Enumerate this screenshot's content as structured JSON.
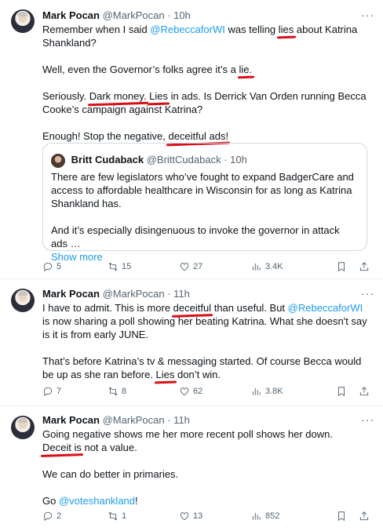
{
  "tweets": [
    {
      "author": "Mark Pocan",
      "handle": "@MarkPocan",
      "dot": "·",
      "time": "10h",
      "more": "···",
      "text": {
        "l1a": "Remember when I said ",
        "l1link": "@RebeccaforWI",
        "l1b": " was telling ",
        "l1u": "lies",
        "l1c": " about Katrina Shankland?",
        "l2a": "Well, even the Governor’s folks agree it’s a ",
        "l2u": "lie.",
        "l3a": "Seriously. ",
        "l3u1": "Dark money.",
        "l3sp": " ",
        "l3u2": "Lies",
        "l3b": " in ads. Is Derrick Van Orden running Becca Cooke’s campaign against Katrina?",
        "l4a": "Enough! Stop the negative, ",
        "l4u": "deceitful ads!"
      },
      "quote": {
        "author": "Britt Cudaback",
        "handle": "@BrittCudaback",
        "dot": "·",
        "time": "10h",
        "p1": "There are few legislators who’ve fought to expand BadgerCare and access to affordable healthcare in Wisconsin for as long as Katrina Shankland has.",
        "p2": "And it’s especially disingenuous to invoke the governor in attack ads …",
        "show_more": "Show more"
      },
      "stats": {
        "replies": "5",
        "reposts": "15",
        "likes": "27",
        "views": "3.4K"
      }
    },
    {
      "author": "Mark Pocan",
      "handle": "@MarkPocan",
      "dot": "·",
      "time": "11h",
      "more": "···",
      "text": {
        "l1a": "I have to admit. This is more ",
        "l1u": "deceitful",
        "l1b": " than useful. But ",
        "l1link": "@RebeccaforWI",
        "l1c": " is now sharing a poll showing her beating Katrina. What she doesn't say is it is from early JUNE.",
        "l2a": "That’s before Katrina’s tv & messaging started. Of course Becca would be up as she ran before. ",
        "l2u": "Lies",
        "l2b": " don’t win."
      },
      "stats": {
        "replies": "7",
        "reposts": "8",
        "likes": "62",
        "views": "3.8K"
      }
    },
    {
      "author": "Mark Pocan",
      "handle": "@MarkPocan",
      "dot": "·",
      "time": "11h",
      "more": "···",
      "text": {
        "l1a": "Going negative shows me her more recent poll shows her down. ",
        "l1u": "Deceit is",
        "l1b": " not a value.",
        "l2": "We can do better in primaries.",
        "l3a": "Go ",
        "l3link": "@voteshankland",
        "l3b": "!"
      },
      "stats": {
        "replies": "2",
        "reposts": "1",
        "likes": "13",
        "views": "852"
      }
    }
  ],
  "icons": [
    "reply-icon",
    "repost-icon",
    "like-icon",
    "views-icon",
    "bookmark-icon",
    "share-icon",
    "more-icon"
  ],
  "colors": {
    "link": "#1d9bf0",
    "muted": "#536471",
    "underline": "#d90f17",
    "border": "#cfd9de"
  }
}
